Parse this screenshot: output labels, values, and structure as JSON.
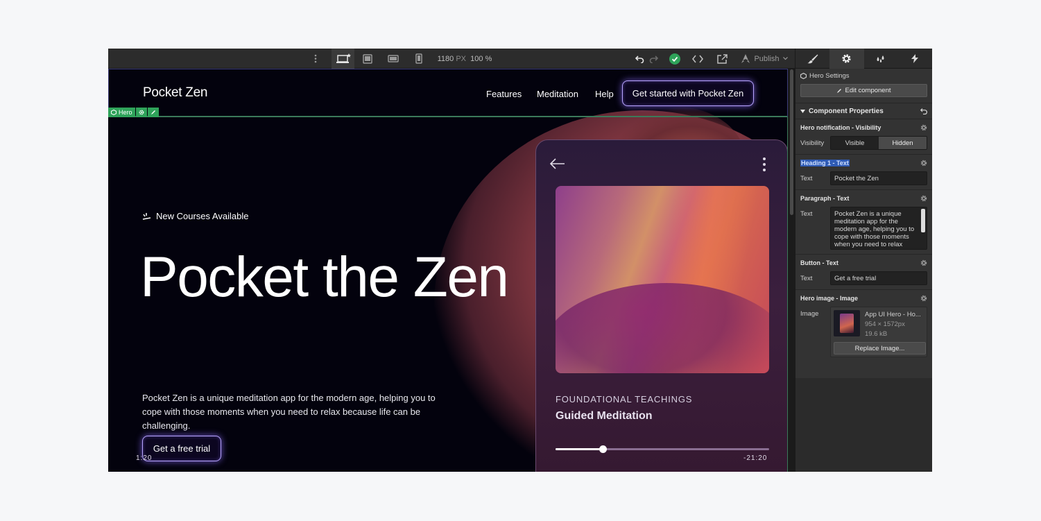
{
  "toolbar": {
    "canvas_width": "1180",
    "canvas_unit": "PX",
    "zoom": "100 %",
    "publish_label": "Publish",
    "status_color": "#2fa35a"
  },
  "site": {
    "brand": "Pocket Zen",
    "nav": [
      "Features",
      "Meditation",
      "Help"
    ],
    "nav_cta": "Get started with Pocket Zen",
    "hero_tag": "Hero",
    "new_courses": "New Courses Available",
    "heading": "Pocket the Zen",
    "paragraph": "Pocket Zen is a unique meditation app for the modern age, helping you to cope with those moments when you need to relax because life can be challenging.",
    "button": "Get a free trial"
  },
  "phone": {
    "eyebrow": "FOUNDATIONAL TEACHINGS",
    "title": "Guided Meditation",
    "progress": 0.22,
    "elapsed": "1:20",
    "remaining": "-21:20"
  },
  "panel": {
    "tabs": [
      "style-tab",
      "settings-tab",
      "interactions-tab",
      "actions-tab"
    ],
    "hero_settings": "Hero Settings",
    "edit_component": "Edit component",
    "component_properties": "Component Properties",
    "visibility": {
      "section": "Hero notification - Visibility",
      "label": "Visibility",
      "options": [
        "Visible",
        "Hidden"
      ],
      "selected": "Hidden"
    },
    "heading": {
      "section": "Heading 1 - Text",
      "label": "Text",
      "value": "Pocket the Zen"
    },
    "paragraph": {
      "section": "Paragraph - Text",
      "label": "Text",
      "value": "Pocket Zen is a unique meditation app for the modern age, helping you to cope with those moments when you need to relax"
    },
    "button": {
      "section": "Button - Text",
      "label": "Text",
      "value": "Get a free trial"
    },
    "image": {
      "section": "Hero image - Image",
      "label": "Image",
      "name": "App UI Hero - Ho...",
      "dimensions": "954 × 1572px",
      "size": "19.6 kB",
      "replace": "Replace Image..."
    }
  }
}
